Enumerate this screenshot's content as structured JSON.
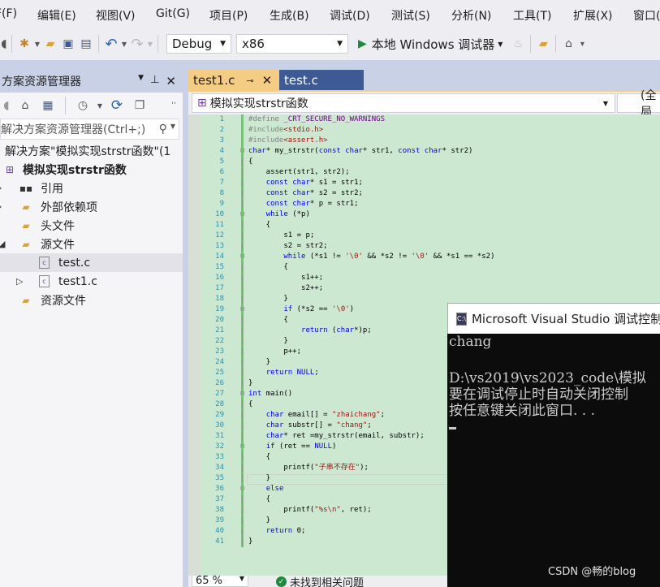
{
  "menu": [
    "F(F)",
    "编辑(E)",
    "视图(V)",
    "Git(G)",
    "项目(P)",
    "生成(B)",
    "调试(D)",
    "测试(S)",
    "分析(N)",
    "工具(T)",
    "扩展(X)",
    "窗口("
  ],
  "toolbar": {
    "config": "Debug",
    "platform": "x86",
    "run_label": "本地 Windows 调试器"
  },
  "solution_explorer": {
    "title": "方案资源管理器",
    "search_placeholder": "解决方案资源管理器(Ctrl+;)",
    "solution_label": "解决方案\"模拟实现strstr函数\"(1",
    "project": "模拟实现strstr函数",
    "items": [
      {
        "label": "引用"
      },
      {
        "label": "外部依赖项"
      },
      {
        "label": "头文件"
      },
      {
        "label": "源文件"
      },
      {
        "label": "test.c"
      },
      {
        "label": "test1.c"
      },
      {
        "label": "资源文件"
      }
    ]
  },
  "tabs": [
    {
      "label": "test1.c",
      "active": true
    },
    {
      "label": "test.c",
      "active": false
    }
  ],
  "nav": {
    "scope": "模拟实现strstr函数",
    "scope2": "(全局"
  },
  "code_lines": [
    "#define _CRT_SECURE_NO_WARNINGS",
    "#include<stdio.h>",
    "#include<assert.h>",
    "char* my_strstr(const char* str1, const char* str2)",
    "{",
    "    assert(str1, str2);",
    "    const char* s1 = str1;",
    "    const char* s2 = str2;",
    "    const char* p = str1;",
    "    while (*p)",
    "    {",
    "        s1 = p;",
    "        s2 = str2;",
    "        while (*s1 != '\\0' && *s2 != '\\0' && *s1 == *s2)",
    "        {",
    "            s1++;",
    "            s2++;",
    "        }",
    "        if (*s2 == '\\0')",
    "        {",
    "            return (char*)p;",
    "        }",
    "        p++;",
    "    }",
    "    return NULL;",
    "}",
    "int main()",
    "{",
    "    char email[] = \"zhaichang\";",
    "    char substr[] = \"chang\";",
    "    char* ret =my_strstr(email, substr);",
    "    if (ret == NULL)",
    "    {",
    "        printf(\"子串不存在\");",
    "    }",
    "    else",
    "    {",
    "        printf(\"%s\\n\", ret);",
    "    }",
    "    return 0;",
    "}"
  ],
  "line_numbers": [
    "1",
    "2",
    "3",
    "4",
    "5",
    "6",
    "7",
    "8",
    "9",
    "10",
    "11",
    "12",
    "13",
    "14",
    "15",
    "16",
    "17",
    "18",
    "19",
    "20",
    "21",
    "22",
    "23",
    "24",
    "25",
    "26",
    "27",
    "28",
    "29",
    "30",
    "31",
    "32",
    "33",
    "34",
    "35",
    "36",
    "37",
    "38",
    "39",
    "40",
    "41"
  ],
  "status": {
    "zoom": "65 %",
    "issues": "未找到相关问题"
  },
  "console": {
    "title": "Microsoft Visual Studio 调试控制",
    "icon_text": "C:\\",
    "lines": [
      "chang",
      "",
      "D:\\vs2019\\vs2023_code\\模拟",
      "要在调试停止时自动关闭控制",
      "按任意键关闭此窗口. . ."
    ]
  },
  "watermark": "CSDN @畅的blog"
}
